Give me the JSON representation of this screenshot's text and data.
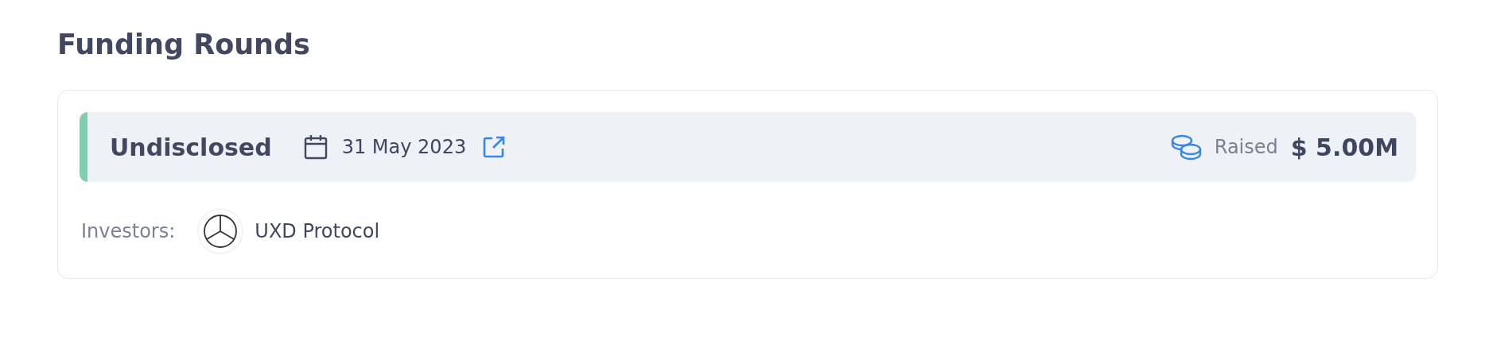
{
  "title": "Funding Rounds",
  "rounds": [
    {
      "type": "Undisclosed",
      "color": "#7fcfae",
      "date": "31 May 2023",
      "raised_label": "Raised",
      "amount": "$ 5.00M",
      "investors_label": "Investors:",
      "investors": [
        {
          "name": "UXD Protocol"
        }
      ]
    }
  ]
}
